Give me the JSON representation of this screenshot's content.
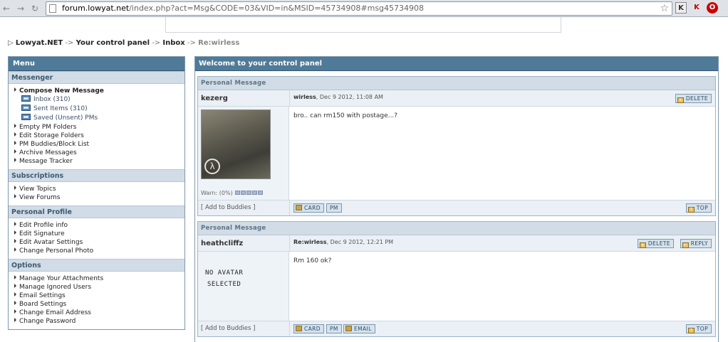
{
  "browser": {
    "url_host": "forum.lowyat.net",
    "url_rest": "/index.php?act=Msg&CODE=03&VID=in&MSID=45734908#msg45734908",
    "ext_labels": [
      "K",
      "K",
      "O"
    ]
  },
  "breadcrumb": [
    {
      "label": "Lowyat.NET"
    },
    {
      "label": "Your control panel"
    },
    {
      "label": "Inbox"
    },
    {
      "label": "Re:wirless"
    }
  ],
  "menu": {
    "title": "Menu",
    "sections": [
      {
        "title": "Messenger",
        "compose": "Compose New Message",
        "folders": [
          "Inbox (310)",
          "Sent Items (310)",
          "Saved (Unsent) PMs"
        ],
        "items": [
          "Empty PM Folders",
          "Edit Storage Folders",
          "PM Buddies/Block List",
          "Archive Messages",
          "Message Tracker"
        ]
      },
      {
        "title": "Subscriptions",
        "items": [
          "View Topics",
          "View Forums"
        ]
      },
      {
        "title": "Personal Profile",
        "items": [
          "Edit Profile info",
          "Edit Signature",
          "Edit Avatar Settings",
          "Change Personal Photo"
        ]
      },
      {
        "title": "Options",
        "items": [
          "Manage Your Attachments",
          "Manage Ignored Users",
          "Email Settings",
          "Board Settings",
          "Change Email Address",
          "Change Password"
        ]
      }
    ]
  },
  "main": {
    "title": "Welcome to your control panel",
    "messages": [
      {
        "header": "Personal Message",
        "author": "kezerg",
        "subject": "wirless",
        "date": ", Dec 9 2012, 11:08 AM",
        "body": "bro.. can rm150 with postage...?",
        "warn": "Warn: (0%)",
        "add_buddies": "[ Add to Buddies ]",
        "buttons_top": [
          "DELETE"
        ],
        "buttons_foot": [
          "CARD",
          "PM"
        ],
        "top_label": "TOP"
      },
      {
        "header": "Personal Message",
        "author": "heathcliffz",
        "subject": "Re:wirless",
        "date": ", Dec 9 2012, 12:21 PM",
        "body": "Rm 160 ok?",
        "no_avatar_1": "NO AVATAR",
        "no_avatar_2": "SELECTED",
        "add_buddies": "[ Add to Buddies ]",
        "buttons_top": [
          "DELETE",
          "REPLY"
        ],
        "buttons_foot": [
          "CARD",
          "PM",
          "EMAIL"
        ],
        "top_label": "TOP"
      }
    ]
  }
}
